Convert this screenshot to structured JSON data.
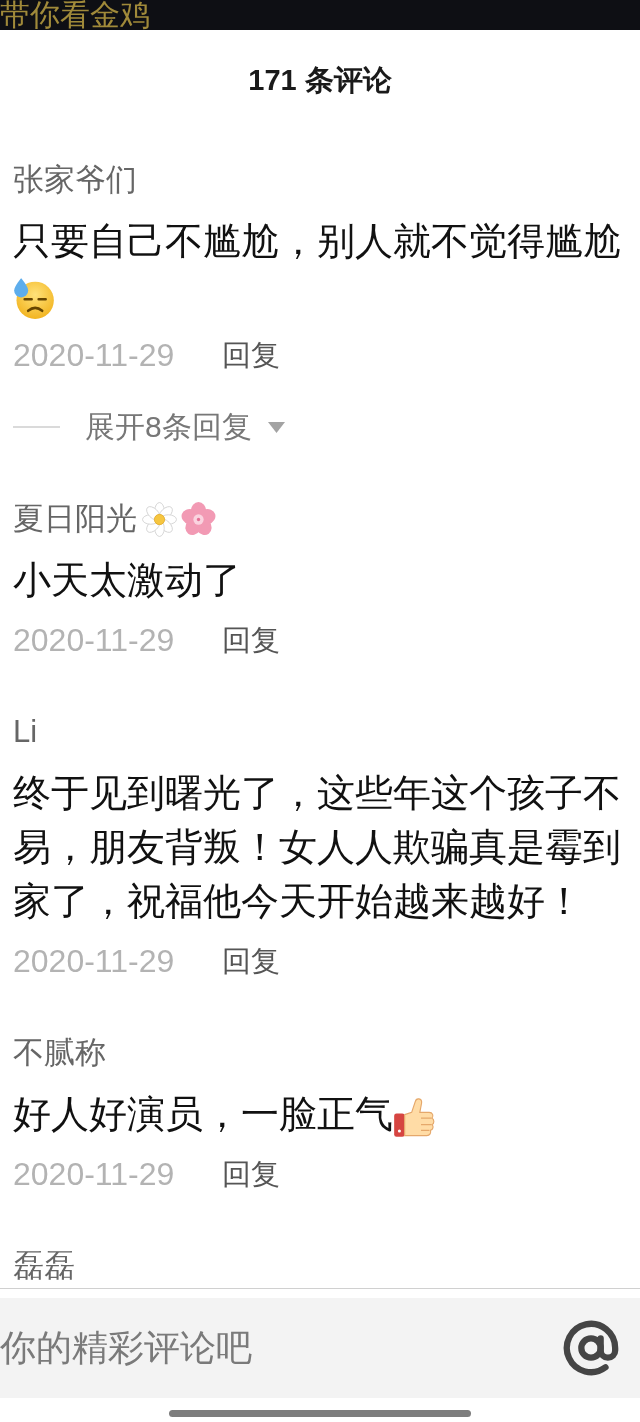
{
  "banner": {
    "title": "带你看金鸡"
  },
  "header": {
    "title": "171 条评论"
  },
  "comments": [
    {
      "user": "张家爷们",
      "text": "只要自己不尴尬，别人就不觉得尴尬",
      "text_emojis": [
        {
          "kind": "sweat-face"
        }
      ],
      "date": "2020-11-29",
      "reply": "回复",
      "more_replies": "展开8条回复"
    },
    {
      "user": "夏日阳光",
      "user_emojis": [
        {
          "kind": "daisy"
        },
        {
          "kind": "blossom"
        }
      ],
      "text": "小天太激动了",
      "date": "2020-11-29",
      "reply": "回复"
    },
    {
      "user": "Li",
      "text": "终于见到曙光了，这些年这个孩子不易，朋友背叛！女人人欺骗真是霉到家了，祝福他今天开始越来越好！",
      "date": "2020-11-29",
      "reply": "回复"
    },
    {
      "user": "不腻称",
      "text": "好人好演员，一脸正气",
      "text_emojis": [
        {
          "kind": "thumbs-up"
        }
      ],
      "date": "2020-11-29",
      "reply": "回复"
    },
    {
      "user": "磊磊"
    }
  ],
  "composer": {
    "placeholder": "你的精彩评论吧"
  }
}
